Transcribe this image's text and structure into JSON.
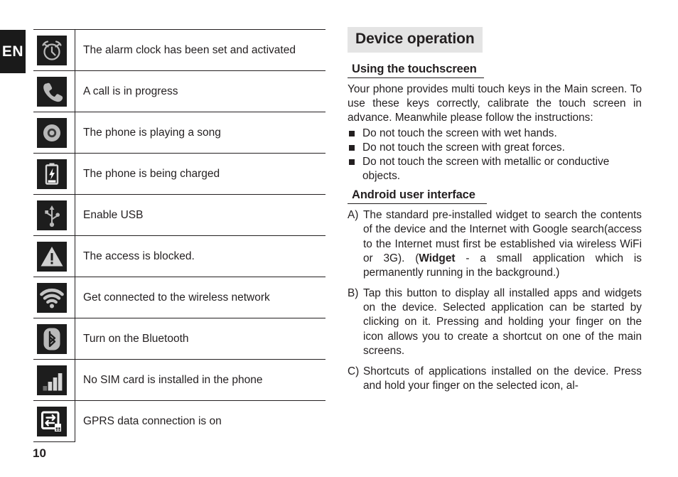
{
  "page": {
    "language_tab": "EN",
    "page_number": "10"
  },
  "status_icons_table": {
    "rows": [
      {
        "icon": "alarm-clock-icon",
        "description": "The alarm clock has been set and activated"
      },
      {
        "icon": "phone-call-icon",
        "description": "A call is in progress"
      },
      {
        "icon": "music-disc-icon",
        "description": "The phone is playing a song"
      },
      {
        "icon": "battery-charging-icon",
        "description": "The phone is being charged"
      },
      {
        "icon": "usb-icon",
        "description": "Enable USB"
      },
      {
        "icon": "warning-triangle-icon",
        "description": "The access is blocked."
      },
      {
        "icon": "wifi-icon",
        "description": "Get connected to the wireless network"
      },
      {
        "icon": "bluetooth-icon",
        "description": "Turn on the Bluetooth"
      },
      {
        "icon": "signal-bars-icon",
        "description": "No SIM card is installed in the phone"
      },
      {
        "icon": "gprs-data-icon",
        "description": "GPRS data connection is on"
      }
    ]
  },
  "device_operation": {
    "banner_title": "Device operation",
    "touchscreen": {
      "heading": "Using the touchscreen",
      "paragraph": "Your phone provides multi touch keys in the Main screen. To use these keys correctly, calibrate the touch screen in advance. Meanwhile please follow the instructions:",
      "bullets": [
        "Do not touch the screen with wet hands.",
        "Do not touch the screen with great forces.",
        "Do not touch the screen with metallic or conductive objects."
      ]
    },
    "android_ui": {
      "heading": "Android user interface",
      "items": [
        {
          "label": "A)",
          "text_before_bold": "The standard pre-installed widget to search the contents of the device and the Internet with Google search(access to the Internet must first be established via wireless WiFi or 3G). (",
          "bold_word": "Widget",
          "text_after_bold": " - a small application which is permanently running in the background.)"
        },
        {
          "label": "B)",
          "text": "Tap this button to display all installed apps and widgets on the device. Selected application can be started by clicking on it. Pressing and holding your finger on the icon allows you to create a shortcut on one of the main screens."
        },
        {
          "label": "C)",
          "text": "Shortcuts of applications installed on the device. Press and hold your finger on the selected icon, al-"
        }
      ]
    }
  },
  "colors": {
    "banner_background": "#e4e4e4",
    "text": "#231f20",
    "icon_tile_background": "#1d1d1d",
    "icon_glyph": "#b9b9b9",
    "tab_background": "#1a1a1a"
  }
}
